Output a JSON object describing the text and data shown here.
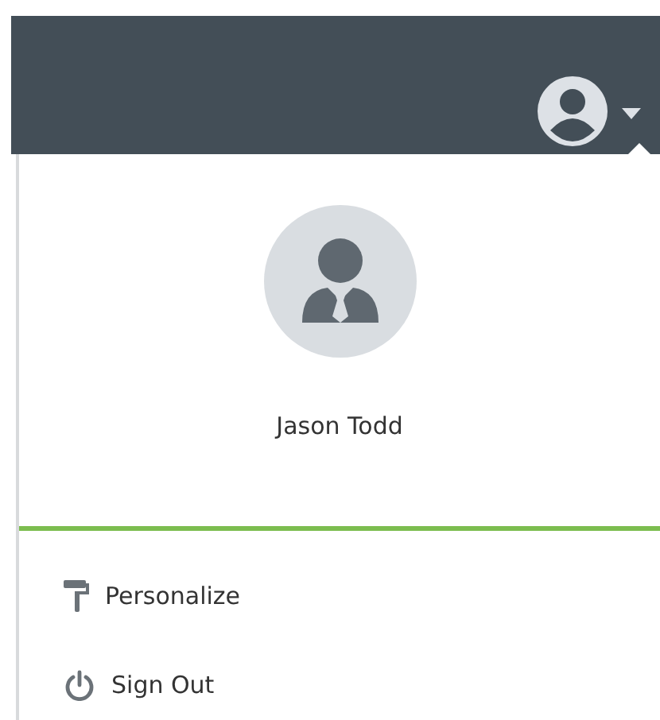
{
  "user": {
    "name": "Jason Todd"
  },
  "menu": [
    {
      "kind": "personalize",
      "label": "Personalize"
    },
    {
      "kind": "sign-out",
      "label": "Sign Out"
    }
  ]
}
